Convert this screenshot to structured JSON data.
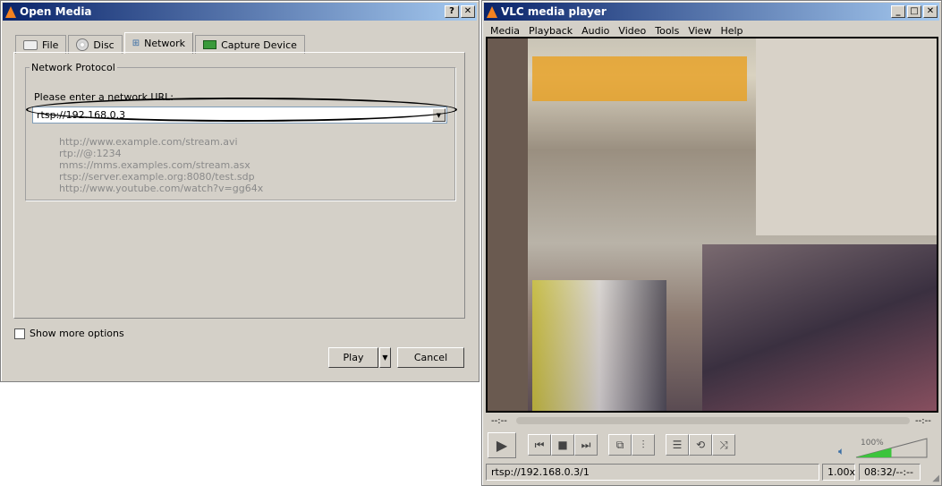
{
  "open_media": {
    "title": "Open Media",
    "help": "?",
    "close": "✕",
    "tabs": [
      {
        "label": "File",
        "icon": "folder-icon"
      },
      {
        "label": "Disc",
        "icon": "disc-icon"
      },
      {
        "label": "Network",
        "icon": "network-icon",
        "active": true
      },
      {
        "label": "Capture Device",
        "icon": "capture-card-icon"
      }
    ],
    "group_title": "Network Protocol",
    "url_label": "Please enter a network URL:",
    "url_value": "rtsp://192.168.0.3",
    "examples": [
      "http://www.example.com/stream.avi",
      "rtp://@:1234",
      "mms://mms.examples.com/stream.asx",
      "rtsp://server.example.org:8080/test.sdp",
      "http://www.youtube.com/watch?v=gg64x"
    ],
    "show_more": "Show more options",
    "play": "Play",
    "cancel": "Cancel"
  },
  "vlc": {
    "title": "VLC media player",
    "menu": [
      "Media",
      "Playback",
      "Audio",
      "Video",
      "Tools",
      "View",
      "Help"
    ],
    "elapsed": "--:--",
    "remaining": "--:--",
    "volume_label": "100%",
    "volume_fraction": 0.5,
    "status_url": "rtsp://192.168.0.3/1",
    "speed": "1.00x",
    "time": "08:32/--:--",
    "accent": "#3cc43c"
  }
}
